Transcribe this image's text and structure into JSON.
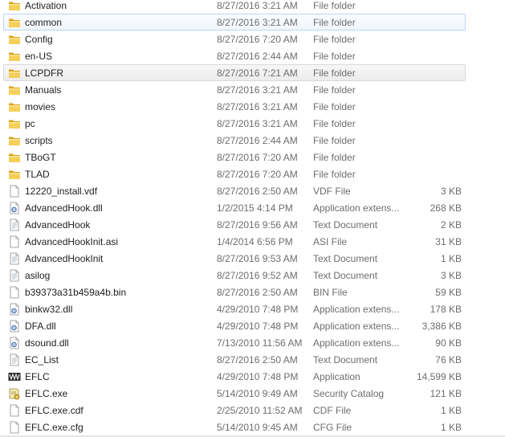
{
  "files": [
    {
      "name": "Activation",
      "date": "8/27/2016 3:21 AM",
      "type": "File folder",
      "size": "",
      "icon": "folder-icon"
    },
    {
      "name": "common",
      "date": "8/27/2016 3:21 AM",
      "type": "File folder",
      "size": "",
      "icon": "folder-icon",
      "state": "hover"
    },
    {
      "name": "Config",
      "date": "8/27/2016 7:20 AM",
      "type": "File folder",
      "size": "",
      "icon": "folder-icon"
    },
    {
      "name": "en-US",
      "date": "8/27/2016 2:44 AM",
      "type": "File folder",
      "size": "",
      "icon": "folder-icon"
    },
    {
      "name": "LCPDFR",
      "date": "8/27/2016 7:21 AM",
      "type": "File folder",
      "size": "",
      "icon": "folder-icon",
      "state": "selected"
    },
    {
      "name": "Manuals",
      "date": "8/27/2016 3:21 AM",
      "type": "File folder",
      "size": "",
      "icon": "folder-icon"
    },
    {
      "name": "movies",
      "date": "8/27/2016 3:21 AM",
      "type": "File folder",
      "size": "",
      "icon": "folder-icon"
    },
    {
      "name": "pc",
      "date": "8/27/2016 3:21 AM",
      "type": "File folder",
      "size": "",
      "icon": "folder-icon"
    },
    {
      "name": "scripts",
      "date": "8/27/2016 2:44 AM",
      "type": "File folder",
      "size": "",
      "icon": "folder-icon"
    },
    {
      "name": "TBoGT",
      "date": "8/27/2016 7:20 AM",
      "type": "File folder",
      "size": "",
      "icon": "folder-icon"
    },
    {
      "name": "TLAD",
      "date": "8/27/2016 7:20 AM",
      "type": "File folder",
      "size": "",
      "icon": "folder-icon"
    },
    {
      "name": "12220_install.vdf",
      "date": "8/27/2016 2:50 AM",
      "type": "VDF File",
      "size": "3 KB",
      "icon": "blank-file-icon"
    },
    {
      "name": "AdvancedHook.dll",
      "date": "1/2/2015 4:14 PM",
      "type": "Application extens...",
      "size": "268 KB",
      "icon": "dll-file-icon"
    },
    {
      "name": "AdvancedHook",
      "date": "8/27/2016 9:56 AM",
      "type": "Text Document",
      "size": "2 KB",
      "icon": "text-file-icon"
    },
    {
      "name": "AdvancedHookInit.asi",
      "date": "1/4/2014 6:56 PM",
      "type": "ASI File",
      "size": "31 KB",
      "icon": "blank-file-icon"
    },
    {
      "name": "AdvancedHookInit",
      "date": "8/27/2016 9:53 AM",
      "type": "Text Document",
      "size": "1 KB",
      "icon": "text-file-icon"
    },
    {
      "name": "asilog",
      "date": "8/27/2016 9:52 AM",
      "type": "Text Document",
      "size": "3 KB",
      "icon": "text-file-icon"
    },
    {
      "name": "b39373a31b459a4b.bin",
      "date": "8/27/2016 2:50 AM",
      "type": "BIN File",
      "size": "59 KB",
      "icon": "blank-file-icon"
    },
    {
      "name": "binkw32.dll",
      "date": "4/29/2010 7:48 PM",
      "type": "Application extens...",
      "size": "178 KB",
      "icon": "dll-file-icon"
    },
    {
      "name": "DFA.dll",
      "date": "4/29/2010 7:48 PM",
      "type": "Application extens...",
      "size": "3,386 KB",
      "icon": "dll-file-icon"
    },
    {
      "name": "dsound.dll",
      "date": "7/13/2010 11:56 AM",
      "type": "Application extens...",
      "size": "90 KB",
      "icon": "dll-file-icon"
    },
    {
      "name": "EC_List",
      "date": "8/27/2016 2:50 AM",
      "type": "Text Document",
      "size": "76 KB",
      "icon": "text-file-icon"
    },
    {
      "name": "EFLC",
      "date": "4/29/2010 7:48 PM",
      "type": "Application",
      "size": "14,599 KB",
      "icon": "eflc-app-icon"
    },
    {
      "name": "EFLC.exe",
      "date": "5/14/2010 9:49 AM",
      "type": "Security Catalog",
      "size": "121 KB",
      "icon": "security-catalog-icon"
    },
    {
      "name": "EFLC.exe.cdf",
      "date": "2/25/2010 11:52 AM",
      "type": "CDF File",
      "size": "1 KB",
      "icon": "blank-file-icon"
    },
    {
      "name": "EFLC.exe.cfg",
      "date": "5/14/2010 9:45 AM",
      "type": "CFG File",
      "size": "1 KB",
      "icon": "blank-file-icon"
    }
  ]
}
